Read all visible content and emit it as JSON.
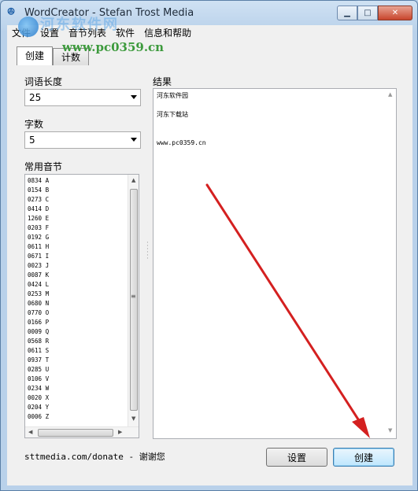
{
  "window": {
    "title": "WordCreator - Stefan Trost Media"
  },
  "watermark": {
    "brand_cn": "河东软件网",
    "url": "www.pc0359.cn"
  },
  "menu": [
    "文件",
    "设置",
    "音节列表",
    "软件",
    "信息和帮助"
  ],
  "tabs": [
    {
      "label": "创建"
    },
    {
      "label": "计数"
    }
  ],
  "form": {
    "word_length_label": "词语长度",
    "word_length_value": "25",
    "word_count_label": "字数",
    "word_count_value": "5",
    "syllables_label": "常用音节",
    "result_label": "结果"
  },
  "syllables": [
    "0834 A",
    "0154 B",
    "0273 C",
    "0414 D",
    "1260 E",
    "0203 F",
    "0192 G",
    "0611 H",
    "0671 I",
    "0023 J",
    "0087 K",
    "0424 L",
    "0253 M",
    "0680 N",
    "0770 O",
    "0166 P",
    "0009 Q",
    "0568 R",
    "0611 S",
    "0937 T",
    "0285 U",
    "0106 V",
    "0234 W",
    "0020 X",
    "0204 Y",
    "0006 Z"
  ],
  "result_lines": [
    "河东软件园",
    "",
    "河东下载站",
    "",
    "",
    "www.pc0359.cn"
  ],
  "footer": {
    "donate": "sttmedia.com/donate - 谢谢您"
  },
  "buttons": {
    "settings": "设置",
    "create": "创建"
  },
  "annotation": {
    "arrow_color": "#d42020"
  }
}
